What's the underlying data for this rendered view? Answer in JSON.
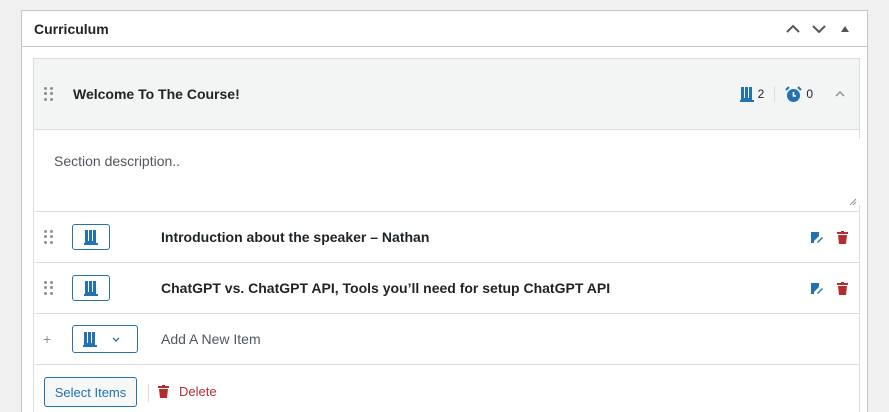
{
  "panel": {
    "title": "Curriculum"
  },
  "section": {
    "title": "Welcome To The Course!",
    "lesson_count": "2",
    "quiz_count": "0",
    "description_placeholder": "Section description.."
  },
  "items": [
    {
      "title": "Introduction about the speaker – Nathan"
    },
    {
      "title": "ChatGPT vs. ChatGPT API, Tools you’ll need for setup ChatGPT API"
    }
  ],
  "new_item": {
    "plus": "+",
    "placeholder": "Add A New Item"
  },
  "footer": {
    "select_label": "Select Items",
    "delete_label": "Delete"
  },
  "colors": {
    "accent": "#2271b1",
    "danger": "#b32d2e",
    "muted": "#8c8f94"
  },
  "icons": [
    "chevron-up-icon",
    "chevron-down-icon",
    "triangle-up-icon",
    "drag-handle-icon",
    "book-icon",
    "alarm-clock-icon",
    "edit-icon",
    "trash-icon"
  ]
}
